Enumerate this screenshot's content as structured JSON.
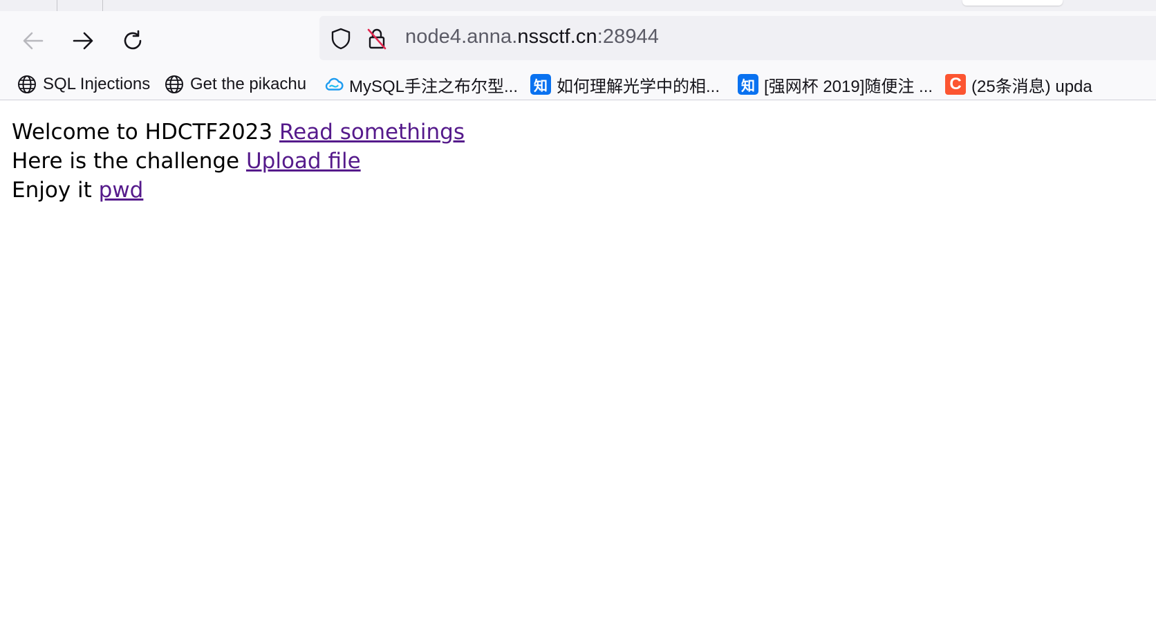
{
  "browser": {
    "nav": {
      "back_icon": "arrow-left-icon",
      "forward_icon": "arrow-right-icon",
      "reload_icon": "reload-icon"
    },
    "url": {
      "prefix": "node4.anna.",
      "domain": "nssctf.cn",
      "suffix": ":28944",
      "shield_icon": "shield-icon",
      "insecure_icon": "insecure-lock-icon"
    },
    "bookmarks": [
      {
        "label": "SQL Injections",
        "icon": "globe-icon"
      },
      {
        "label": "Get the pikachu",
        "icon": "globe-icon"
      },
      {
        "label": "MySQL手注之布尔型...",
        "icon": "cloud-icon"
      },
      {
        "label": "如何理解光学中的相...",
        "icon": "zhihu-icon",
        "icon_text": "知"
      },
      {
        "label": "[强网杯 2019]随便注 ...",
        "icon": "zhihu-icon",
        "icon_text": "知"
      },
      {
        "label": "(25条消息) upda",
        "icon": "csdn-icon",
        "icon_text": "C"
      }
    ]
  },
  "page": {
    "lines": [
      {
        "text": "Welcome to HDCTF2023 ",
        "link": "Read somethings"
      },
      {
        "text": "Here is the challenge ",
        "link": "Upload file"
      },
      {
        "text": "Enjoy it ",
        "link": "pwd"
      }
    ]
  },
  "colors": {
    "link_visited": "#551a8b",
    "zhihu_blue": "#0a72f0",
    "csdn_orange": "#fc5531",
    "toolbar_bg": "#f9f9fb",
    "urlbar_bg": "#f0f0f4"
  }
}
